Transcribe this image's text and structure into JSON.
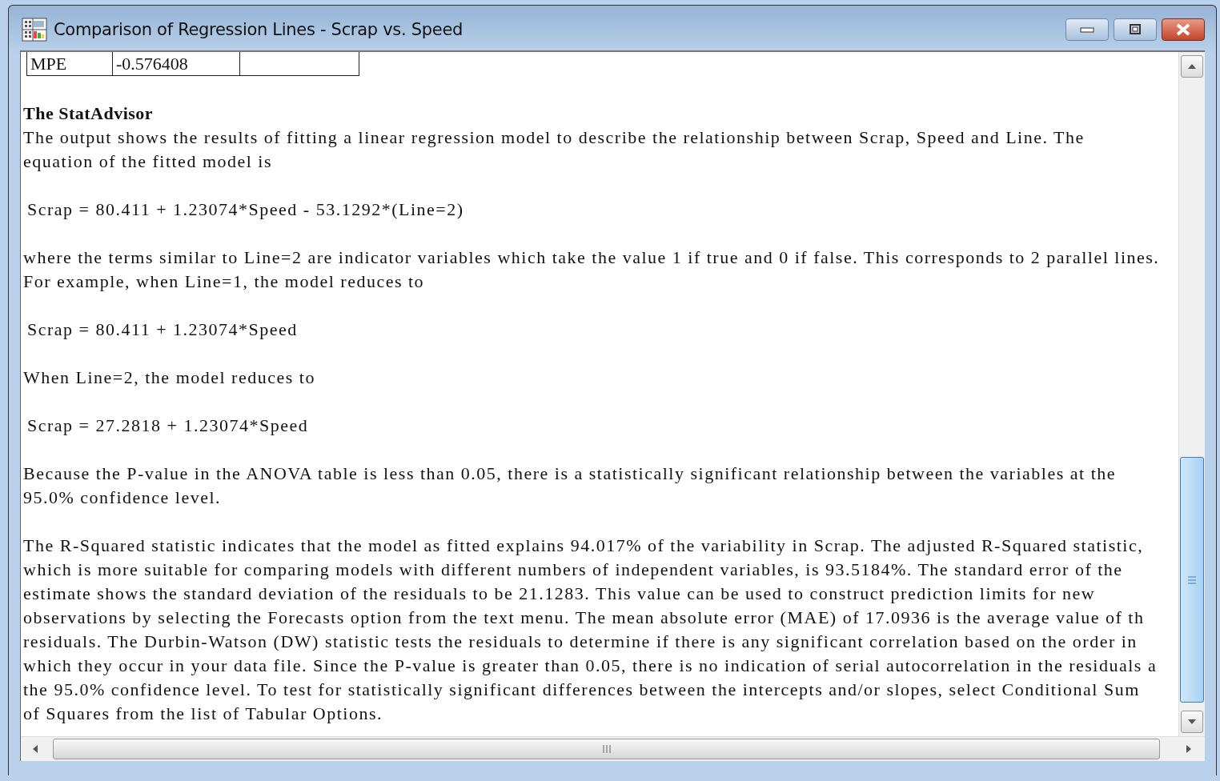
{
  "window": {
    "title": "Comparison of Regression Lines - Scrap vs. Speed"
  },
  "table": {
    "rows": [
      [
        "MPE",
        "-0.576408"
      ]
    ]
  },
  "stat_advisor": {
    "heading": "The StatAdvisor",
    "blocks": [
      {
        "kind": "paragraph",
        "lines": [
          "The output shows the results of fitting a linear regression model to describe the relationship between Scrap, Speed and Line.  The",
          "equation of the fitted model is"
        ]
      },
      {
        "kind": "equation",
        "lines": [
          "Scrap = 80.411 + 1.23074*Speed  - 53.1292*(Line=2)"
        ]
      },
      {
        "kind": "paragraph",
        "lines": [
          "where the terms similar to Line=2 are indicator variables which take the value 1 if true and 0 if false.  This corresponds to 2 parallel lines.",
          "For example, when Line=1, the model reduces to"
        ]
      },
      {
        "kind": "equation",
        "lines": [
          "Scrap = 80.411 + 1.23074*Speed"
        ]
      },
      {
        "kind": "paragraph",
        "lines": [
          "When Line=2, the model reduces to"
        ]
      },
      {
        "kind": "equation",
        "lines": [
          "Scrap = 27.2818 + 1.23074*Speed"
        ]
      },
      {
        "kind": "paragraph",
        "lines": [
          "Because the P-value in the ANOVA table is less than 0.05, there is a statistically significant relationship between the variables at the",
          "95.0% confidence level."
        ]
      },
      {
        "kind": "paragraph",
        "lines": [
          "The R-Squared statistic indicates that the model as fitted explains 94.017% of the variability in Scrap.  The adjusted R-Squared statistic,",
          "which is more suitable for comparing models with different numbers of independent variables, is 93.5184%.  The standard error of the",
          "estimate shows the standard deviation of the residuals to be 21.1283.  This value can be used to construct prediction limits for new",
          "observations by selecting the Forecasts option from the text menu.  The mean absolute error (MAE) of 17.0936 is the average value of th",
          "residuals.  The Durbin-Watson (DW) statistic tests the residuals to determine if there is any significant correlation based on the order in",
          "which they occur in your data file.  Since the P-value is greater than 0.05, there is no indication of serial autocorrelation in the residuals a",
          "the 95.0% confidence level.  To test for statistically significant differences between the intercepts and/or slopes, select Conditional Sum",
          "of Squares from the list of Tabular Options."
        ]
      }
    ]
  }
}
